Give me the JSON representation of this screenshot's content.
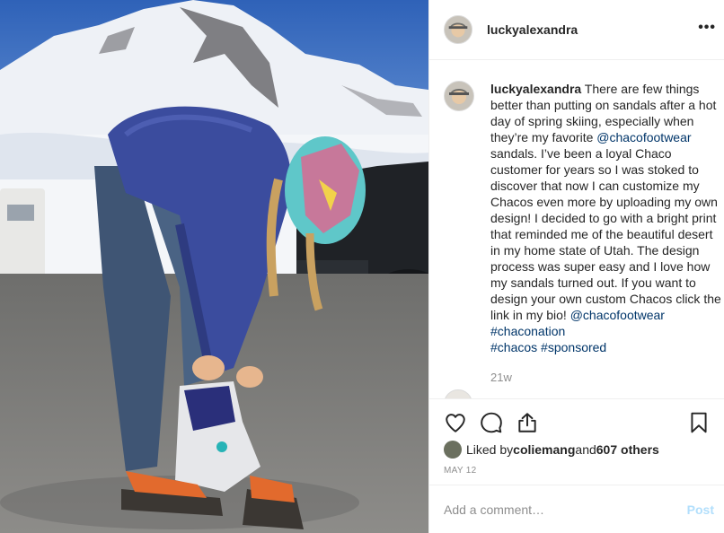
{
  "post": {
    "username": "luckyalexandra",
    "more_icon": "more-horizontal-icon",
    "caption": {
      "username": "luckyalexandra",
      "text_1": " There are few things better than putting on sandals after a hot day of spring skiing, especially when they’re my favorite ",
      "mention_1": "@chacofootwear",
      "text_2": " sandals. I’ve been a loyal Chaco customer for years so I was stoked to discover that now I can customize my Chacos even more by uploading my own design! I decided to go with a bright print that reminded me of the beautiful desert in my home state of Utah. The design process was super easy and I love how my sandals turned out. If you want to design your own custom Chacos click the link in my bio! ",
      "mention_2": "@chacofootwear",
      "space_1": " ",
      "hashtag_1": "#chaconation",
      "hashtag_2": "#chacos",
      "space_2": " ",
      "hashtag_3": "#sponsored"
    },
    "age": "21w",
    "likes": {
      "prefix": "Liked by ",
      "user": "coliemang",
      "and": " and ",
      "others": "607 others"
    },
    "date": "MAY 12",
    "add_comment_placeholder": "Add a comment…",
    "post_button": "Post",
    "icons": {
      "like": "heart-icon",
      "comment": "comment-icon",
      "share": "share-icon",
      "save": "bookmark-icon"
    },
    "colors": {
      "link": "#003569",
      "muted": "#8e8e8e",
      "post_button": "#b2dffc",
      "border": "#efefef"
    }
  }
}
